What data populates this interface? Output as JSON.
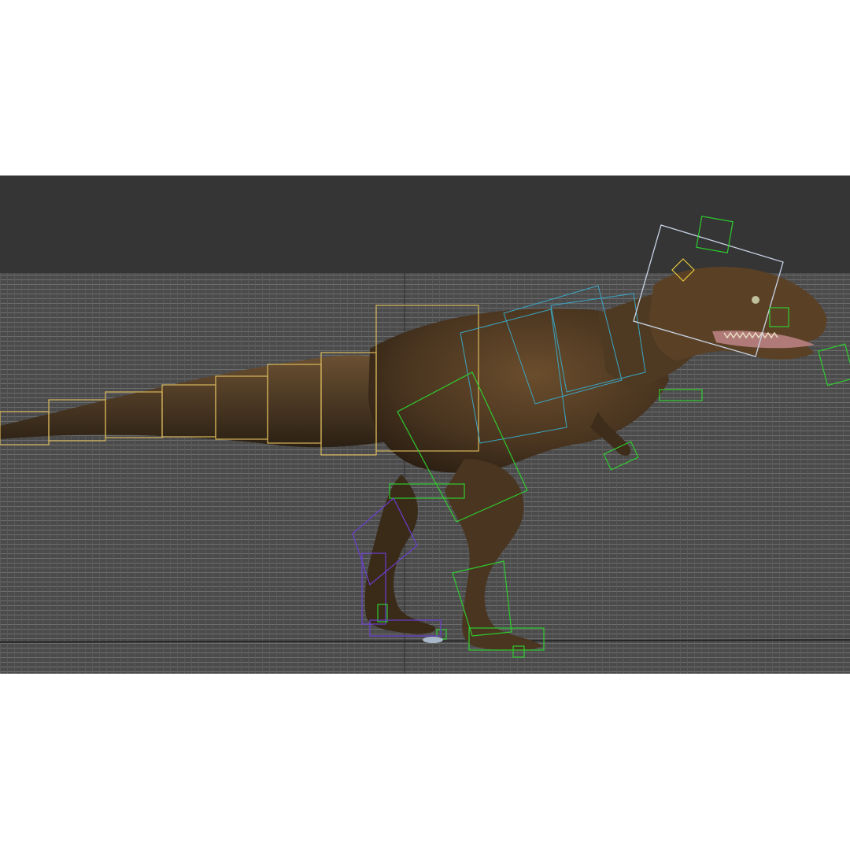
{
  "viewport": {
    "background_color": "#353535",
    "grid_color": "#7a7a7a",
    "grid_floor_color": "#4a4a4a",
    "model": "tyrannosaurus-rex",
    "rig_colors": {
      "spine_controls": "#d9b85c",
      "neck_controls": "#3aa6c4",
      "head_control": "#c9d4e6",
      "right_leg_controls": "#2ecc2e",
      "left_leg_controls": "#6a3fd0",
      "skin": "#4a3520"
    }
  }
}
